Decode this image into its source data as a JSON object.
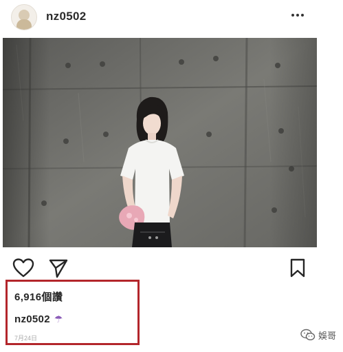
{
  "post": {
    "username": "nz0502",
    "likes_text": "6,916個讚",
    "caption_user": "nz0502",
    "caption_emoji": "☂",
    "date": "7月24日"
  },
  "icons": {
    "avatar": "avatar-icon",
    "more": "more-horizontal-icon",
    "like": "heart-icon",
    "share": "paper-plane-icon",
    "save": "bookmark-icon",
    "watermark": "wechat-icon"
  },
  "watermark": {
    "text": "娛哥"
  },
  "colors": {
    "highlight_border": "#b3262b",
    "text_primary": "#262626",
    "text_secondary": "#a8a8a8"
  }
}
